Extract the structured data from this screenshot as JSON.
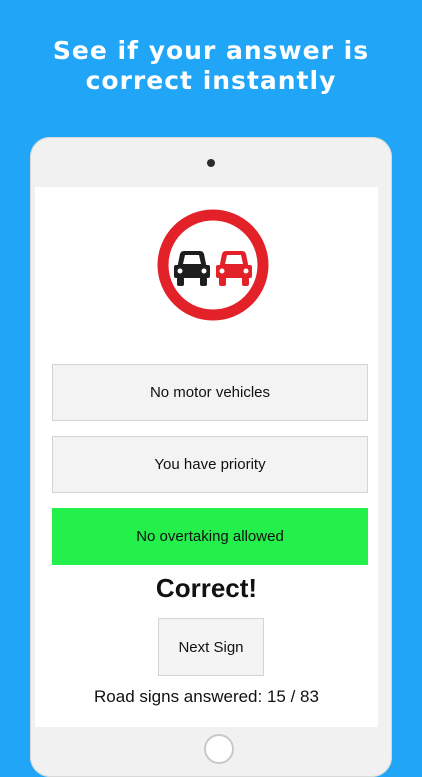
{
  "headline": {
    "line1": "See if your answer is",
    "line2": "correct instantly"
  },
  "colors": {
    "background": "#21a6f7",
    "correct": "#23f04b",
    "sign_ring": "#e32129",
    "car_left": "#1e1e1e",
    "car_right": "#e32129"
  },
  "quiz": {
    "sign_icon": "no-overtaking-sign-icon",
    "answers": [
      {
        "label": "No motor vehicles",
        "state": "neutral"
      },
      {
        "label": "You have priority",
        "state": "neutral"
      },
      {
        "label": "No overtaking allowed",
        "state": "correct"
      }
    ],
    "feedback": "Correct!",
    "next_label": "Next Sign",
    "progress_label": "Road signs answered:",
    "answered": 15,
    "total": 83,
    "progress_text": "Road signs answered: 15 / 83"
  }
}
